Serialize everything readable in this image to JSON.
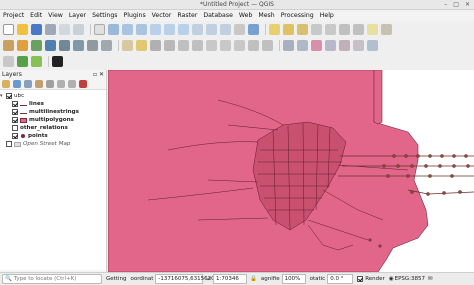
{
  "window": {
    "title": "*Untitled Project — QGIS"
  },
  "menu": [
    "Project",
    "Edit",
    "View",
    "Layer",
    "Settings",
    "Plugins",
    "Vector",
    "Raster",
    "Database",
    "Web",
    "Mesh",
    "Processing",
    "Help"
  ],
  "layers_panel": {
    "title": "Layers",
    "group": "ubc",
    "items": [
      {
        "label": "lines",
        "checked": true,
        "bold": true
      },
      {
        "label": "multilinestrings",
        "checked": true,
        "bold": true
      },
      {
        "label": "multipolygons",
        "checked": true,
        "bold": true,
        "symbol_color": "#e06a8a"
      },
      {
        "label": "other_relations",
        "checked": false,
        "bold": true
      },
      {
        "label": "points",
        "checked": true,
        "bold": true
      }
    ],
    "basemap": "Open Street Map"
  },
  "colors": {
    "map_fill": "#e1668a",
    "map_line": "#7a2a3a",
    "route": "#6a2f2a"
  },
  "statusbar": {
    "locator_placeholder": "Type to locate (Ctrl+K)",
    "getting_label": "Getting",
    "coordinate_label": "oordinat",
    "coordinate_value": "-13716075,6315620",
    "scale_value": "1:70346",
    "magnifier_label": "agnifie",
    "magnifier_value": "100%",
    "rotation_label": "otatic",
    "rotation_value": "0.0 °",
    "render_label": "Render",
    "crs_label": "EPSG:3857"
  }
}
